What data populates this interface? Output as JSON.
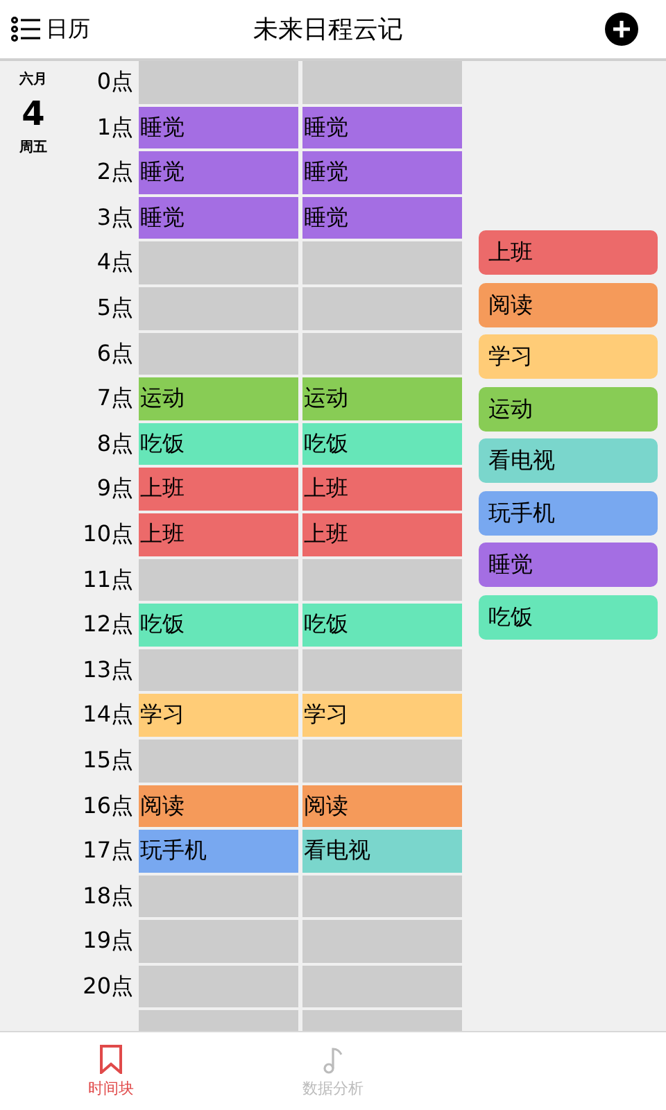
{
  "header": {
    "menu_label": "日历",
    "title": "未来日程云记"
  },
  "date": {
    "month": "六月",
    "day": "4",
    "weekday": "周五"
  },
  "rows": [
    {
      "hour": "0点",
      "cells": [
        {
          "kind": "empty"
        },
        {
          "kind": "empty"
        }
      ]
    },
    {
      "hour": "1点",
      "cells": [
        {
          "kind": "activity",
          "label": "睡觉",
          "color": "#a46ee3"
        },
        {
          "kind": "activity",
          "label": "睡觉",
          "color": "#a46ee3"
        }
      ]
    },
    {
      "hour": "2点",
      "cells": [
        {
          "kind": "activity",
          "label": "睡觉",
          "color": "#a46ee3"
        },
        {
          "kind": "activity",
          "label": "睡觉",
          "color": "#a46ee3"
        }
      ]
    },
    {
      "hour": "3点",
      "cells": [
        {
          "kind": "activity",
          "label": "睡觉",
          "color": "#a46ee3"
        },
        {
          "kind": "activity",
          "label": "睡觉",
          "color": "#a46ee3"
        }
      ]
    },
    {
      "hour": "4点",
      "cells": [
        {
          "kind": "empty"
        },
        {
          "kind": "empty"
        }
      ]
    },
    {
      "hour": "5点",
      "cells": [
        {
          "kind": "empty"
        },
        {
          "kind": "empty"
        }
      ]
    },
    {
      "hour": "6点",
      "cells": [
        {
          "kind": "empty"
        },
        {
          "kind": "empty"
        }
      ]
    },
    {
      "hour": "7点",
      "cells": [
        {
          "kind": "activity",
          "label": "运动",
          "color": "#88cc55"
        },
        {
          "kind": "activity",
          "label": "运动",
          "color": "#88cc55"
        }
      ]
    },
    {
      "hour": "8点",
      "cells": [
        {
          "kind": "activity",
          "label": "吃饭",
          "color": "#66e6b8"
        },
        {
          "kind": "activity",
          "label": "吃饭",
          "color": "#66e6b8"
        }
      ]
    },
    {
      "hour": "9点",
      "cells": [
        {
          "kind": "activity",
          "label": "上班",
          "color": "#ec6a6a"
        },
        {
          "kind": "activity",
          "label": "上班",
          "color": "#ec6a6a"
        }
      ]
    },
    {
      "hour": "10点",
      "cells": [
        {
          "kind": "activity",
          "label": "上班",
          "color": "#ec6a6a"
        },
        {
          "kind": "activity",
          "label": "上班",
          "color": "#ec6a6a"
        }
      ]
    },
    {
      "hour": "11点",
      "cells": [
        {
          "kind": "empty"
        },
        {
          "kind": "empty"
        }
      ]
    },
    {
      "hour": "12点",
      "cells": [
        {
          "kind": "activity",
          "label": "吃饭",
          "color": "#66e6b8"
        },
        {
          "kind": "activity",
          "label": "吃饭",
          "color": "#66e6b8"
        }
      ]
    },
    {
      "hour": "13点",
      "cells": [
        {
          "kind": "empty"
        },
        {
          "kind": "empty"
        }
      ]
    },
    {
      "hour": "14点",
      "cells": [
        {
          "kind": "activity",
          "label": "学习",
          "color": "#ffcc77"
        },
        {
          "kind": "activity",
          "label": "学习",
          "color": "#ffcc77"
        }
      ]
    },
    {
      "hour": "15点",
      "cells": [
        {
          "kind": "empty"
        },
        {
          "kind": "empty"
        }
      ]
    },
    {
      "hour": "16点",
      "cells": [
        {
          "kind": "activity",
          "label": "阅读",
          "color": "#f59a5a"
        },
        {
          "kind": "activity",
          "label": "阅读",
          "color": "#f59a5a"
        }
      ]
    },
    {
      "hour": "17点",
      "cells": [
        {
          "kind": "activity",
          "label": "玩手机",
          "color": "#78a8f0"
        },
        {
          "kind": "activity",
          "label": "看电视",
          "color": "#7ad6cc"
        }
      ]
    },
    {
      "hour": "18点",
      "cells": [
        {
          "kind": "empty"
        },
        {
          "kind": "empty"
        }
      ]
    },
    {
      "hour": "19点",
      "cells": [
        {
          "kind": "empty"
        },
        {
          "kind": "empty"
        }
      ]
    },
    {
      "hour": "20点",
      "cells": [
        {
          "kind": "empty"
        },
        {
          "kind": "empty"
        }
      ]
    },
    {
      "cells": [
        {
          "kind": "empty"
        },
        {
          "kind": "empty"
        }
      ]
    }
  ],
  "palette": [
    {
      "label": "上班",
      "color": "#ec6a6a"
    },
    {
      "label": "阅读",
      "color": "#f59a5a"
    },
    {
      "label": "学习",
      "color": "#ffcc77"
    },
    {
      "label": "运动",
      "color": "#88cc55"
    },
    {
      "label": "看电视",
      "color": "#7ad6cc"
    },
    {
      "label": "玩手机",
      "color": "#78a8f0"
    },
    {
      "label": "睡觉",
      "color": "#a46ee3"
    },
    {
      "label": "吃饭",
      "color": "#66e6b8"
    }
  ],
  "tabs": [
    {
      "label": "时间块",
      "selected": true
    },
    {
      "label": "数据分析",
      "selected": false
    }
  ]
}
